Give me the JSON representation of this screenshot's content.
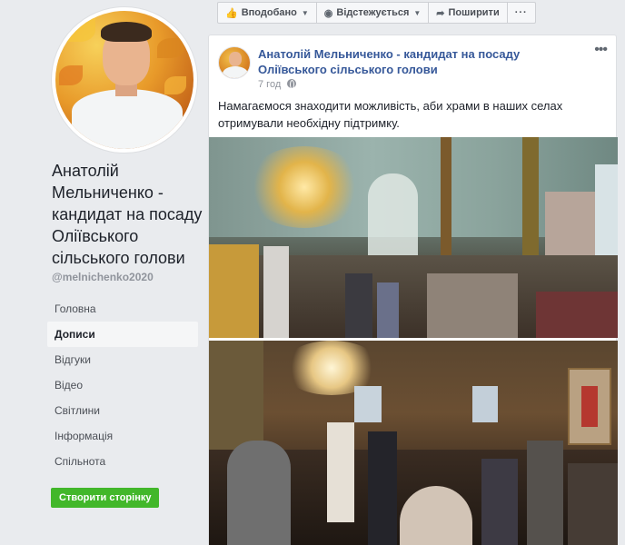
{
  "page": {
    "name": "Анатолій Мельниченко - кандидат на посаду Оліївського сільського голови",
    "handle": "@melnichenko2020"
  },
  "nav": {
    "items": [
      "Головна",
      "Дописи",
      "Відгуки",
      "Відео",
      "Світлини",
      "Інформація",
      "Спільнота"
    ],
    "active": "Дописи",
    "create_page": "Створити сторінку"
  },
  "actions": {
    "liked": "Вподобано",
    "following": "Відстежується",
    "share": "Поширити",
    "more": "···"
  },
  "post": {
    "author": "Анатолій Мельниченко - кандидат на посаду Оліївського сільського голови",
    "time": "7 год",
    "text": "Намагаємося знаходити можливість, аби храми в наших селах отримували необхідну підтримку."
  },
  "colors": {
    "link": "#365899",
    "green": "#42b72a",
    "background": "#e9ebee"
  }
}
